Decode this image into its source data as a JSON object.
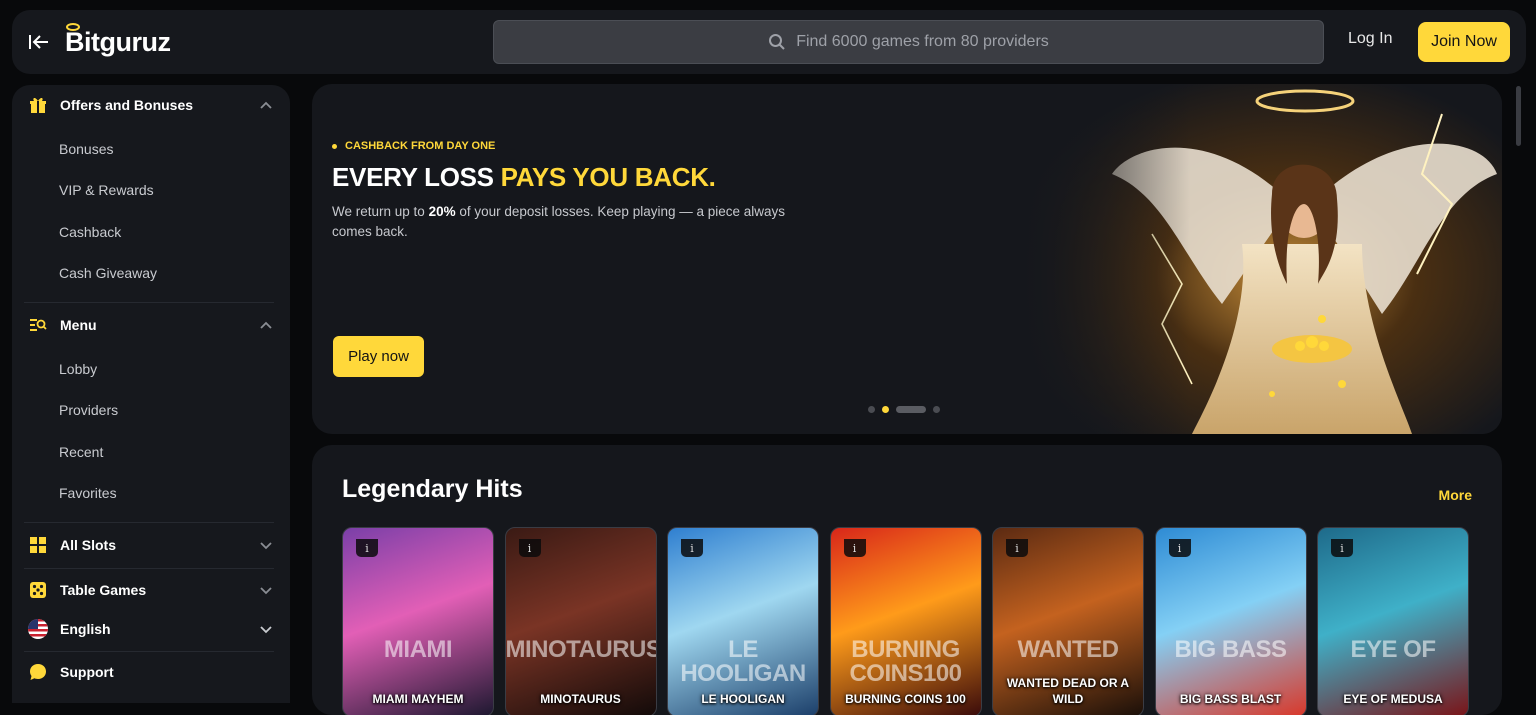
{
  "header": {
    "logo_text": "Bitguruz",
    "search_placeholder": "Find 6000 games from 80 providers",
    "login_label": "Log In",
    "join_label": "Join Now"
  },
  "sidebar": {
    "offers": {
      "title": "Offers and Bonuses",
      "items": [
        "Bonuses",
        "VIP & Rewards",
        "Cashback",
        "Cash Giveaway"
      ]
    },
    "menu": {
      "title": "Menu",
      "items": [
        "Lobby",
        "Providers",
        "Recent",
        "Favorites"
      ]
    },
    "all_slots": "All Slots",
    "table_games": "Table Games",
    "language": "English",
    "support": "Support"
  },
  "hero": {
    "kicker": "CASHBACK FROM DAY ONE",
    "headline_main": "EVERY LOSS ",
    "headline_accent": "PAYS YOU BACK.",
    "desc_before": "We return up to ",
    "desc_bold": "20%",
    "desc_after": " of your deposit losses. Keep playing — a piece always comes back.",
    "cta": "Play now",
    "active_slide": 2,
    "slide_count": 4
  },
  "hits": {
    "title": "Legendary Hits",
    "more": "More",
    "games": [
      {
        "name": "MIAMI MAYHEM",
        "logo": "MIAMI",
        "colors": [
          "#7a3fa8",
          "#e25fb6",
          "#1d1830"
        ]
      },
      {
        "name": "MINOTAURUS",
        "logo": "MINOTAURUS",
        "colors": [
          "#3a1a14",
          "#7a3425",
          "#120a09"
        ]
      },
      {
        "name": "LE HOOLIGAN",
        "logo": "LE HOOLIGAN",
        "colors": [
          "#2f7fd0",
          "#9fd7f0",
          "#1c3f6a"
        ]
      },
      {
        "name": "BURNING COINS 100",
        "logo": "BURNING COINS100",
        "colors": [
          "#d8261a",
          "#ff9b1a",
          "#3a0b0b"
        ]
      },
      {
        "name": "WANTED DEAD OR A WILD",
        "logo": "WANTED",
        "colors": [
          "#5b2a12",
          "#c4621f",
          "#1a0f09"
        ]
      },
      {
        "name": "BIG BASS BLAST",
        "logo": "BIG BASS",
        "colors": [
          "#2e8bd4",
          "#84d0f5",
          "#d9382a"
        ]
      },
      {
        "name": "EYE OF MEDUSA",
        "logo": "EYE OF",
        "colors": [
          "#1e6a8a",
          "#3fb0c8",
          "#7a1418"
        ]
      }
    ]
  }
}
